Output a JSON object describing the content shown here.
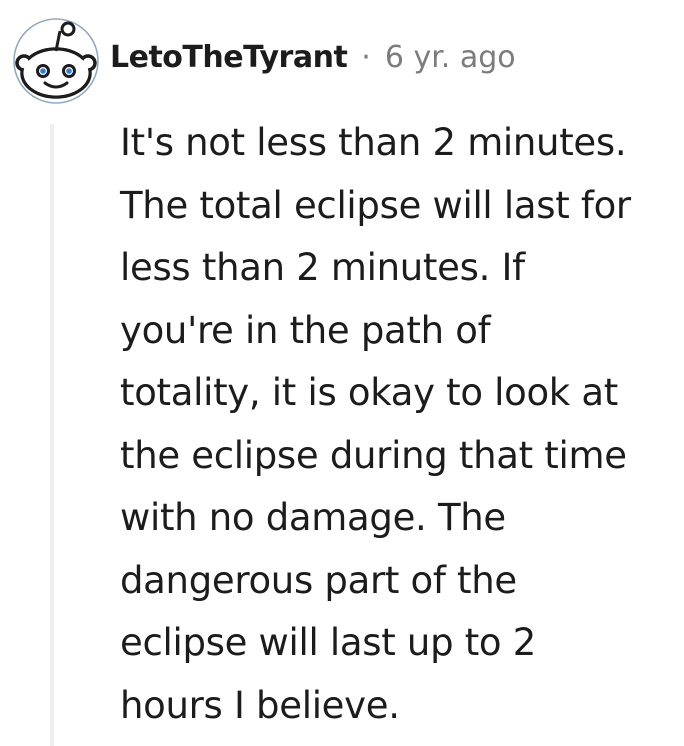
{
  "comment": {
    "author": "LetoTheTyrant",
    "separator": "·",
    "timestamp": "6 yr. ago",
    "avatar_icon": "snoo-avatar-icon",
    "body_lines": [
      "It's not less than 2 minutes.",
      "The total eclipse will last for",
      "less than 2 minutes. If",
      "you're in the path of",
      "totality, it is okay to look at",
      "the eclipse during that time",
      "with no damage. The",
      "dangerous part of the",
      "eclipse will last up to 2",
      "hours I believe."
    ]
  },
  "colors": {
    "text": "#1c1c1c",
    "meta": "#7c7c7c",
    "thread_line": "#edeff1",
    "avatar_bg": "#0079d3",
    "avatar_ring": "#e8eef6"
  }
}
